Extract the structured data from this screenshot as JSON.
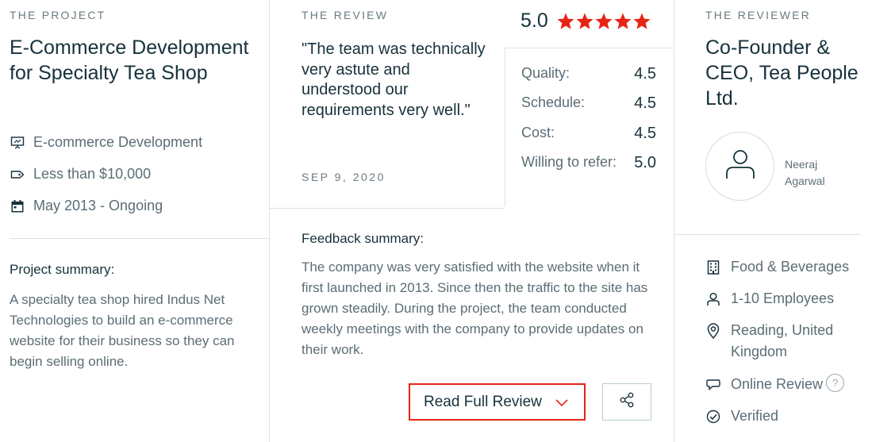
{
  "project": {
    "eyebrow": "THE PROJECT",
    "title": "E-Commerce Development for Specialty Tea Shop",
    "meta": [
      {
        "icon": "presentation-icon",
        "text": "E-commerce Development"
      },
      {
        "icon": "price-tag-icon",
        "text": "Less than $10,000"
      },
      {
        "icon": "calendar-icon",
        "text": "May 2013 - Ongoing"
      }
    ],
    "summary_heading": "Project summary:",
    "summary_text": "A specialty tea shop hired Indus Net Technologies to build an e-commerce website for their business so they can begin selling online."
  },
  "review": {
    "eyebrow": "THE REVIEW",
    "quote": "\"The team was technically very astute and understood our requirements very well.\"",
    "date": "SEP 9, 2020",
    "overall": "5.0",
    "star_color": "#e62415",
    "stars_count": 5,
    "ratings": [
      {
        "label": "Quality:",
        "value": "4.5"
      },
      {
        "label": "Schedule:",
        "value": "4.5"
      },
      {
        "label": "Cost:",
        "value": "4.5"
      },
      {
        "label": "Willing to refer:",
        "value": "5.0"
      }
    ],
    "feedback_heading": "Feedback summary:",
    "feedback_text": "The company was very satisfied with the website when it first launched in 2013. Since then the traffic to the site has grown steadily. During the project, the team conducted weekly meetings with the company to provide updates on their work.",
    "read_button": "Read Full Review",
    "share_icon": "share-icon"
  },
  "reviewer": {
    "eyebrow": "THE REVIEWER",
    "title": "Co-Founder & CEO, Tea People Ltd.",
    "avatar_icon": "user-icon",
    "name": "Neeraj Agarwal",
    "details": [
      {
        "icon": "building-icon",
        "text": "Food & Beverages"
      },
      {
        "icon": "person-icon",
        "text": "1-10 Employees"
      },
      {
        "icon": "location-pin-icon",
        "text": "Reading, United Kingdom"
      },
      {
        "icon": "chat-bubble-icon",
        "text": "Online Review",
        "help": "?"
      },
      {
        "icon": "check-circle-icon",
        "text": "Verified"
      }
    ]
  }
}
